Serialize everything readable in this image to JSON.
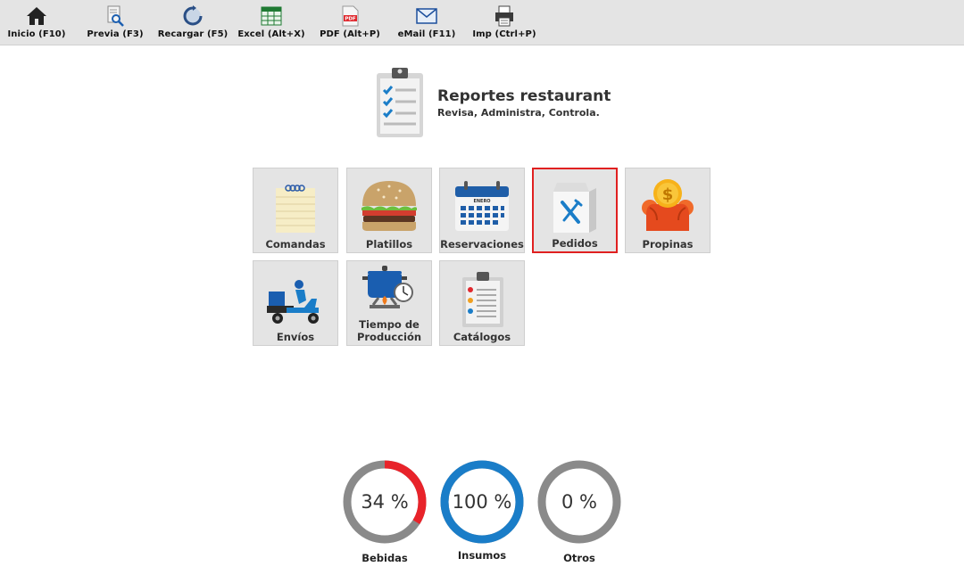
{
  "toolbar": {
    "inicio": "Inicio (F10)",
    "previa": "Previa (F3)",
    "recargar": "Recargar (F5)",
    "excel": "Excel (Alt+X)",
    "pdf": "PDF (Alt+P)",
    "email": "eMail (F11)",
    "imp": "Imp (Ctrl+P)"
  },
  "header": {
    "title": "Reportes restaurant",
    "subtitle": "Revisa, Administra, Controla."
  },
  "tiles": [
    {
      "label": "Comandas",
      "icon": "notepad-icon"
    },
    {
      "label": "Platillos",
      "icon": "burger-icon"
    },
    {
      "label": "Reservaciones",
      "icon": "calendar-icon",
      "calendar_text": "ENERO"
    },
    {
      "label": "Pedidos",
      "icon": "takeout-bag-icon",
      "selected": true
    },
    {
      "label": "Propinas",
      "icon": "tip-coin-icon"
    },
    {
      "label": "Envíos",
      "icon": "delivery-scooter-icon"
    },
    {
      "label": "Tiempo de Producción",
      "line1": "Tiempo de",
      "line2": "Producción",
      "icon": "cooking-pot-icon"
    },
    {
      "label": "Catálogos",
      "icon": "clipboard-icon"
    }
  ],
  "gauges": [
    {
      "label": "Bebidas",
      "value_text": "34 %",
      "value": 34,
      "color": "#e8232a"
    },
    {
      "label": "Insumos",
      "value_text": "100 %",
      "value": 100,
      "color": "#1a7dc8"
    },
    {
      "label": "Otros",
      "value_text": "0 %",
      "value": 0,
      "color": "#1a7dc8"
    }
  ],
  "colors": {
    "toolbar_bg": "#e4e4e4",
    "tile_bg": "#e4e4e4",
    "selected_border": "#e02020",
    "gauge_track": "#8a8a8a"
  }
}
